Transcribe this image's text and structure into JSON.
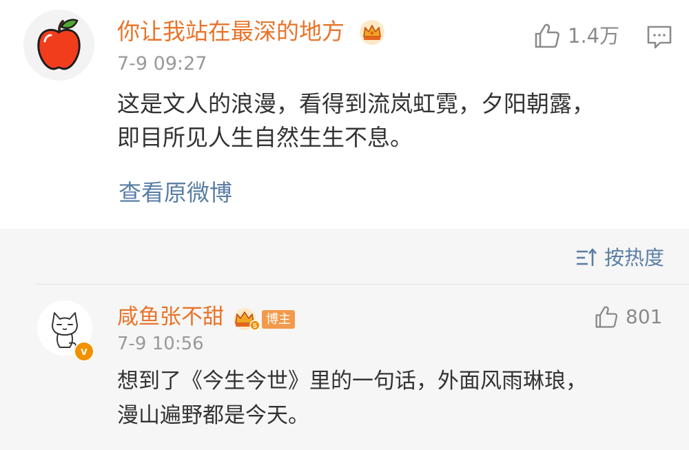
{
  "main_comment": {
    "username": "你让我站在最深的地方",
    "like_count": "1.4万",
    "timestamp": "7-9 09:27",
    "body_lines": [
      "这是文人的浪漫，看得到流岚虹霓，夕阳朝露，",
      "即目所见人生自然生生不息。"
    ],
    "view_original_label": "查看原微博",
    "icons": {
      "avatar": "apple-avatar",
      "badge": "crown-icon",
      "like": "thumbs-up-icon",
      "comment": "comment-icon"
    }
  },
  "replies": {
    "sort_label": "按热度",
    "sort_icon": "sort-icon",
    "items": [
      {
        "username": "咸鱼张不甜",
        "tag": "博主",
        "crown_level": "5",
        "verified_label": "v",
        "like_count": "801",
        "timestamp": "7-9 10:56",
        "body_lines": [
          "想到了《今生今世》里的一句话，外面风雨琳琅，",
          "漫山遍野都是今天。"
        ],
        "icons": {
          "avatar": "cat-avatar",
          "badge": "crown-icon",
          "verified": "verified-badge-icon",
          "like": "thumbs-up-icon"
        }
      }
    ]
  },
  "colors": {
    "username": "#e8742a",
    "link": "#5a7ea6",
    "body_text": "#333333",
    "meta_text": "#999999",
    "reply_background": "#f6f6f6",
    "badge_orange": "#f29100"
  }
}
